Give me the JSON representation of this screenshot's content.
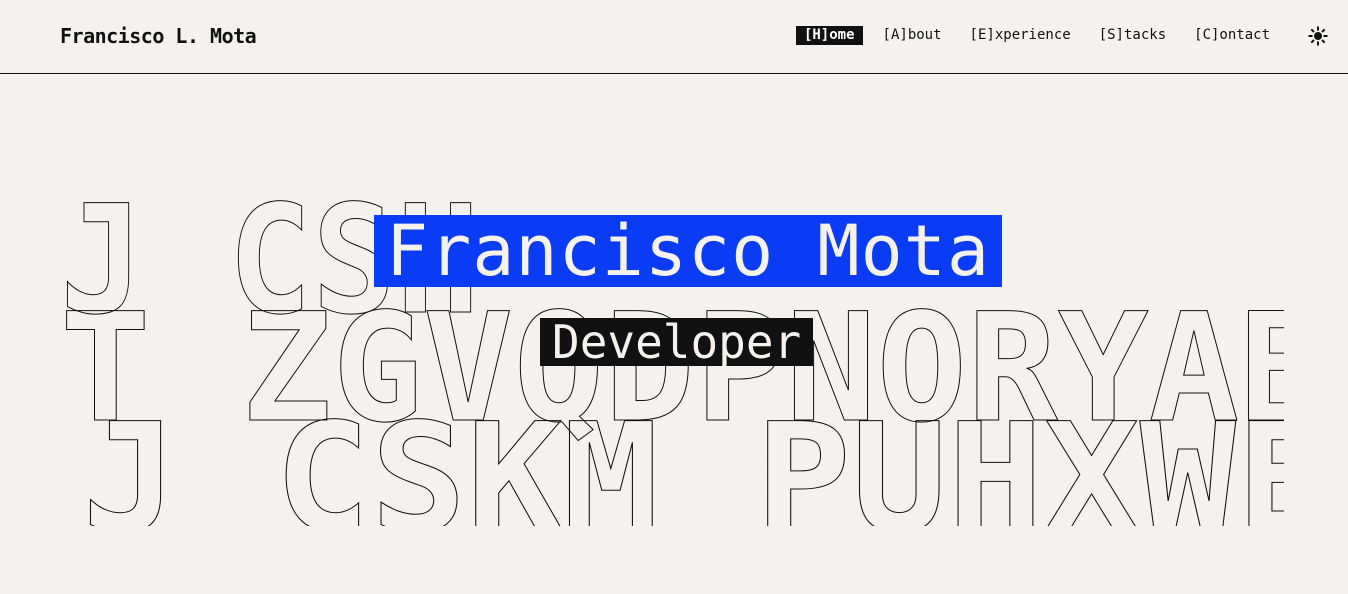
{
  "header": {
    "brand": "Francisco L. Mota",
    "nav": [
      {
        "label": "[H]ome",
        "active": true
      },
      {
        "label": "[A]bout",
        "active": false
      },
      {
        "label": "[E]xperience",
        "active": false
      },
      {
        "label": "[S]tacks",
        "active": false
      },
      {
        "label": "[C]ontact",
        "active": false
      }
    ],
    "theme_toggle_icon": "sun-icon"
  },
  "hero": {
    "name": "Francisco Mota",
    "role": "Developer"
  },
  "background": {
    "rows": [
      "J CSH",
      "T ZGVQDPNORYAB",
      "J CSKM PUHXWE"
    ]
  },
  "colors": {
    "background": "#f5f2ee",
    "accent": "#0a3cf5",
    "text": "#111111"
  }
}
